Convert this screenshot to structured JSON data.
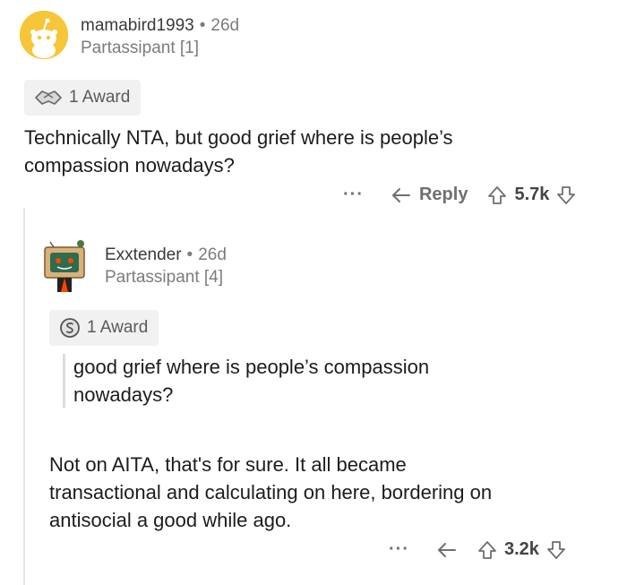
{
  "comment1": {
    "username": "mamabird1993",
    "separator": "•",
    "age": "26d",
    "flair": "Partassipant [1]",
    "award_label": "1 Award",
    "text_line1": "Technically NTA, but good grief where is people’s",
    "text_line2": "compassion nowadays?",
    "more_label": "···",
    "reply_label": "Reply",
    "score": "5.7k"
  },
  "comment2": {
    "username": "Exxtender",
    "separator": "•",
    "age": "26d",
    "flair": "Partassipant [4]",
    "award_label": "1 Award",
    "quote_line1": "good grief where is people’s compassion",
    "quote_line2": "nowadays?",
    "text_line1": "Not on AITA, that's for sure. It all became",
    "text_line2": "transactional and calculating on here, bordering on",
    "text_line3": "antisocial a good while ago.",
    "more_label": "···",
    "score": "3.2k"
  },
  "colors": {
    "avatar1_bg": "#f7c538",
    "text": "#1c1c1c",
    "muted": "#7c7c7c",
    "pill_bg": "#f1f1f1"
  }
}
